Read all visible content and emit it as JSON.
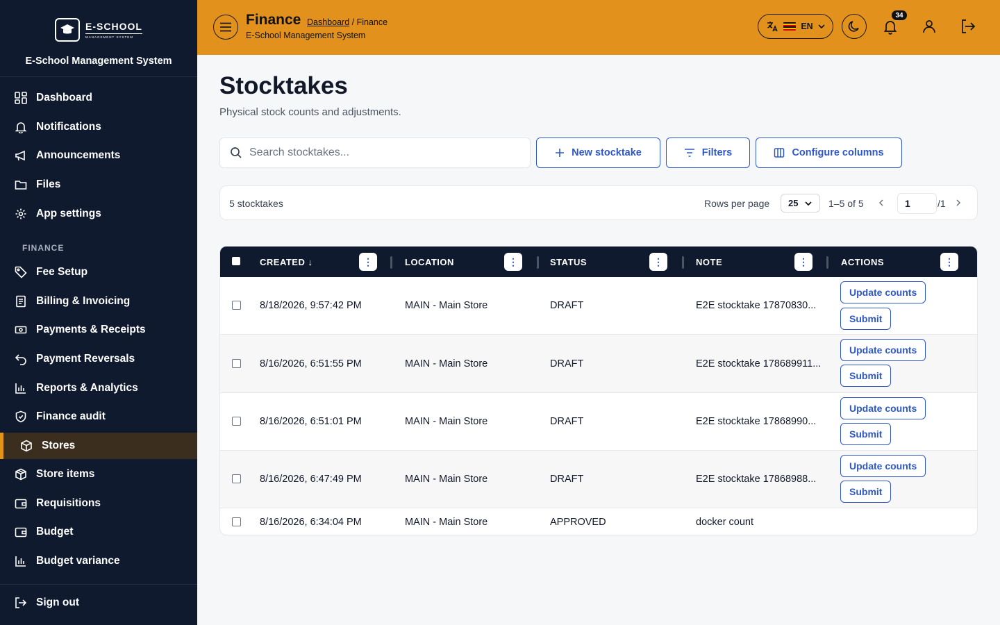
{
  "sidebar": {
    "logo_text": "E-SCHOOL",
    "logo_sub": "MANAGEMENT SYSTEM",
    "app_name": "E-School Management System",
    "items": [
      {
        "label": "Dashboard",
        "icon": "dashboard-icon"
      },
      {
        "label": "Notifications",
        "icon": "bell-icon"
      },
      {
        "label": "Announcements",
        "icon": "megaphone-icon"
      },
      {
        "label": "Files",
        "icon": "folder-icon"
      },
      {
        "label": "App settings",
        "icon": "gear-icon"
      }
    ],
    "section_finance": "FINANCE",
    "finance_items": [
      {
        "label": "Fee Setup",
        "icon": "tag-icon"
      },
      {
        "label": "Billing & Invoicing",
        "icon": "invoice-icon"
      },
      {
        "label": "Payments & Receipts",
        "icon": "cash-icon"
      },
      {
        "label": "Payment Reversals",
        "icon": "undo-icon"
      },
      {
        "label": "Reports & Analytics",
        "icon": "bar-chart-icon"
      },
      {
        "label": "Finance audit",
        "icon": "shield-icon"
      },
      {
        "label": "Stores",
        "icon": "box-icon",
        "active": true
      },
      {
        "label": "Store items",
        "icon": "package-icon"
      },
      {
        "label": "Requisitions",
        "icon": "wallet-icon"
      },
      {
        "label": "Budget",
        "icon": "wallet-icon"
      },
      {
        "label": "Budget variance",
        "icon": "bar-chart-icon"
      }
    ],
    "sign_out": "Sign out"
  },
  "header": {
    "title": "Finance",
    "crumb_link": "Dashboard",
    "crumb_current": "/ Finance",
    "subtitle": "E-School Management System",
    "language": "EN",
    "notification_count": "34",
    "accent": "#e2911c"
  },
  "main": {
    "title": "Stocktakes",
    "description": "Physical stock counts and adjustments.",
    "search_placeholder": "Search stocktakes...",
    "new_button": "New stocktake",
    "filters_button": "Filters",
    "columns_button": "Configure columns"
  },
  "pager": {
    "count": "5 stocktakes",
    "rows_per_page_label": "Rows per page",
    "rows_per_page": "25",
    "range": "1–5 of 5",
    "page": "1",
    "total_pages": "/1"
  },
  "table": {
    "columns": [
      "CREATED",
      "LOCATION",
      "STATUS",
      "NOTE",
      "ACTIONS"
    ],
    "rows": [
      {
        "created": "8/18/2026, 9:57:42 PM",
        "location": "MAIN - Main Store",
        "status": "DRAFT",
        "note": "E2E stocktake 17870830...",
        "actions": [
          "Update counts",
          "Submit"
        ]
      },
      {
        "created": "8/16/2026, 6:51:55 PM",
        "location": "MAIN - Main Store",
        "status": "DRAFT",
        "note": "E2E stocktake 178689911...",
        "actions": [
          "Update counts",
          "Submit"
        ]
      },
      {
        "created": "8/16/2026, 6:51:01 PM",
        "location": "MAIN - Main Store",
        "status": "DRAFT",
        "note": "E2E stocktake 17868990...",
        "actions": [
          "Update counts",
          "Submit"
        ]
      },
      {
        "created": "8/16/2026, 6:47:49 PM",
        "location": "MAIN - Main Store",
        "status": "DRAFT",
        "note": "E2E stocktake 17868988...",
        "actions": [
          "Update counts",
          "Submit"
        ]
      },
      {
        "created": "8/16/2026, 6:34:04 PM",
        "location": "MAIN - Main Store",
        "status": "APPROVED",
        "note": "docker count",
        "actions": []
      }
    ]
  }
}
